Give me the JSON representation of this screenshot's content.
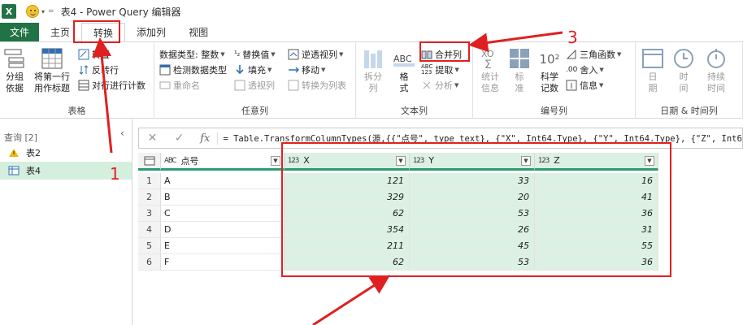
{
  "window": {
    "title": "表4 - Power Query 编辑器",
    "app_icon": "X"
  },
  "tabs": [
    "文件",
    "主页",
    "转换",
    "添加列",
    "视图"
  ],
  "ribbon": {
    "groups": {
      "table": "表格",
      "any_column": "任意列",
      "text_column": "文本列",
      "number_column": "编号列",
      "datetime_column": "日期 & 时间列"
    },
    "table": {
      "group_by": "分组\n依据",
      "first_row_header": "将第一行\n用作标题",
      "transpose": "转置",
      "reverse_rows": "反转行",
      "count_rows": "对行进行计数"
    },
    "any_column": {
      "data_type": "数据类型: 整数",
      "detect_type": "检测数据类型",
      "rename": "重命名",
      "replace_values": "替换值",
      "fill": "填充",
      "pivot": "透视列",
      "unpivot": "逆透视列",
      "move": "移动",
      "to_list": "转换为列表"
    },
    "text_column": {
      "split": "拆分\n列",
      "format": "格\n式",
      "merge": "合并列",
      "extract": "提取",
      "parse": "分析"
    },
    "number_column": {
      "stats": "统计\n信息",
      "standard": "标\n准",
      "scientific": "科学\n记数",
      "trig": "三角函数",
      "rounding": "舍入",
      "info": "信息",
      "sci_glyph": "10²"
    },
    "datetime_column": {
      "date": "日\n期",
      "time": "时\n间",
      "duration": "持续\n时间"
    }
  },
  "queries": {
    "header": "查询 [2]",
    "items": [
      "表2",
      "表4"
    ],
    "selected": "表4"
  },
  "formula": "= Table.TransformColumnTypes(源,{{\"点号\", type text}, {\"X\", Int64.Type}, {\"Y\", Int64.Type}, {\"Z\", Int64.Type}})",
  "formula_buttons": {
    "cancel": "✕",
    "confirm": "✓",
    "fx": "fx"
  },
  "table": {
    "columns": [
      {
        "name": "点号",
        "type": "ABC"
      },
      {
        "name": "X",
        "type": "123"
      },
      {
        "name": "Y",
        "type": "123"
      },
      {
        "name": "Z",
        "type": "123"
      }
    ],
    "rows": [
      [
        "A",
        "121",
        "33",
        "16"
      ],
      [
        "B",
        "329",
        "20",
        "41"
      ],
      [
        "C",
        "62",
        "53",
        "36"
      ],
      [
        "D",
        "354",
        "26",
        "31"
      ],
      [
        "E",
        "211",
        "45",
        "55"
      ],
      [
        "F",
        "62",
        "53",
        "36"
      ]
    ],
    "row_numbers": [
      "1",
      "2",
      "3",
      "4",
      "5",
      "6"
    ]
  },
  "annotations": [
    "1",
    "3"
  ],
  "colors": {
    "excel_green": "#217346",
    "accent_teal": "#2d9b72",
    "highlight_red": "#e02020",
    "selection_green": "#dcf0e3"
  }
}
